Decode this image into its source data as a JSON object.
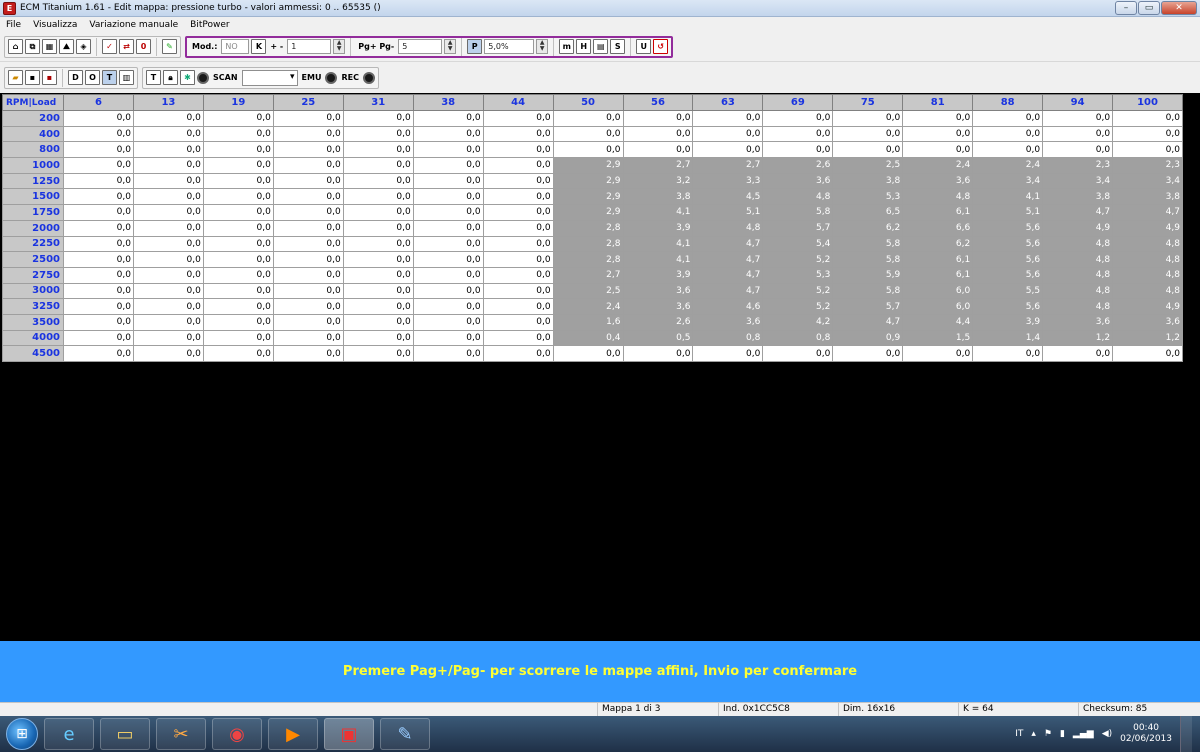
{
  "window": {
    "title": "ECM Titanium 1.61 - Edit mappa: pressione turbo - valori ammessi: 0 .. 65535 ()"
  },
  "menu": [
    "File",
    "Visualizza",
    "Variazione manuale",
    "BitPower"
  ],
  "toolbar": {
    "mod_label": "Mod.:",
    "mod_value": "NO",
    "k_label": "K",
    "plusminus_label": "+ -",
    "plusminus_value": "1",
    "pg_label": "Pg+ Pg-",
    "pg_value": "5",
    "percent_value": "5,0%",
    "scan_label": "SCAN",
    "emu_label": "EMU",
    "rec_label": "REC"
  },
  "table": {
    "corner": "RPM|Load",
    "loads": [
      "6",
      "13",
      "19",
      "25",
      "31",
      "38",
      "44",
      "50",
      "56",
      "63",
      "69",
      "75",
      "81",
      "88",
      "94",
      "100"
    ],
    "rows": [
      {
        "rpm": "200",
        "vals": [
          "0,0",
          "0,0",
          "0,0",
          "0,0",
          "0,0",
          "0,0",
          "0,0",
          "0,0",
          "0,0",
          "0,0",
          "0,0",
          "0,0",
          "0,0",
          "0,0",
          "0,0",
          "0,0"
        ]
      },
      {
        "rpm": "400",
        "vals": [
          "0,0",
          "0,0",
          "0,0",
          "0,0",
          "0,0",
          "0,0",
          "0,0",
          "0,0",
          "0,0",
          "0,0",
          "0,0",
          "0,0",
          "0,0",
          "0,0",
          "0,0",
          "0,0"
        ]
      },
      {
        "rpm": "800",
        "vals": [
          "0,0",
          "0,0",
          "0,0",
          "0,0",
          "0,0",
          "0,0",
          "0,0",
          "0,0",
          "0,0",
          "0,0",
          "0,0",
          "0,0",
          "0,0",
          "0,0",
          "0,0",
          "0,0"
        ]
      },
      {
        "rpm": "1000",
        "vals": [
          "0,0",
          "0,0",
          "0,0",
          "0,0",
          "0,0",
          "0,0",
          "0,0",
          "2,9",
          "2,7",
          "2,7",
          "2,6",
          "2,5",
          "2,4",
          "2,4",
          "2,3",
          "2,3"
        ]
      },
      {
        "rpm": "1250",
        "vals": [
          "0,0",
          "0,0",
          "0,0",
          "0,0",
          "0,0",
          "0,0",
          "0,0",
          "2,9",
          "3,2",
          "3,3",
          "3,6",
          "3,8",
          "3,6",
          "3,4",
          "3,4",
          "3,4"
        ]
      },
      {
        "rpm": "1500",
        "vals": [
          "0,0",
          "0,0",
          "0,0",
          "0,0",
          "0,0",
          "0,0",
          "0,0",
          "2,9",
          "3,8",
          "4,5",
          "4,8",
          "5,3",
          "4,8",
          "4,1",
          "3,8",
          "3,8"
        ]
      },
      {
        "rpm": "1750",
        "vals": [
          "0,0",
          "0,0",
          "0,0",
          "0,0",
          "0,0",
          "0,0",
          "0,0",
          "2,9",
          "4,1",
          "5,1",
          "5,8",
          "6,5",
          "6,1",
          "5,1",
          "4,7",
          "4,7"
        ]
      },
      {
        "rpm": "2000",
        "vals": [
          "0,0",
          "0,0",
          "0,0",
          "0,0",
          "0,0",
          "0,0",
          "0,0",
          "2,8",
          "3,9",
          "4,8",
          "5,7",
          "6,2",
          "6,6",
          "5,6",
          "4,9",
          "4,9"
        ]
      },
      {
        "rpm": "2250",
        "vals": [
          "0,0",
          "0,0",
          "0,0",
          "0,0",
          "0,0",
          "0,0",
          "0,0",
          "2,8",
          "4,1",
          "4,7",
          "5,4",
          "5,8",
          "6,2",
          "5,6",
          "4,8",
          "4,8"
        ]
      },
      {
        "rpm": "2500",
        "vals": [
          "0,0",
          "0,0",
          "0,0",
          "0,0",
          "0,0",
          "0,0",
          "0,0",
          "2,8",
          "4,1",
          "4,7",
          "5,2",
          "5,8",
          "6,1",
          "5,6",
          "4,8",
          "4,8"
        ]
      },
      {
        "rpm": "2750",
        "vals": [
          "0,0",
          "0,0",
          "0,0",
          "0,0",
          "0,0",
          "0,0",
          "0,0",
          "2,7",
          "3,9",
          "4,7",
          "5,3",
          "5,9",
          "6,1",
          "5,6",
          "4,8",
          "4,8"
        ]
      },
      {
        "rpm": "3000",
        "vals": [
          "0,0",
          "0,0",
          "0,0",
          "0,0",
          "0,0",
          "0,0",
          "0,0",
          "2,5",
          "3,6",
          "4,7",
          "5,2",
          "5,8",
          "6,0",
          "5,5",
          "4,8",
          "4,8"
        ]
      },
      {
        "rpm": "3250",
        "vals": [
          "0,0",
          "0,0",
          "0,0",
          "0,0",
          "0,0",
          "0,0",
          "0,0",
          "2,4",
          "3,6",
          "4,6",
          "5,2",
          "5,7",
          "6,0",
          "5,6",
          "4,8",
          "4,9"
        ]
      },
      {
        "rpm": "3500",
        "vals": [
          "0,0",
          "0,0",
          "0,0",
          "0,0",
          "0,0",
          "0,0",
          "0,0",
          "1,6",
          "2,6",
          "3,6",
          "4,2",
          "4,7",
          "4,4",
          "3,9",
          "3,6",
          "3,6"
        ]
      },
      {
        "rpm": "4000",
        "vals": [
          "0,0",
          "0,0",
          "0,0",
          "0,0",
          "0,0",
          "0,0",
          "0,0",
          "0,4",
          "0,5",
          "0,8",
          "0,8",
          "0,9",
          "1,5",
          "1,4",
          "1,2",
          "1,2"
        ]
      },
      {
        "rpm": "4500",
        "vals": [
          "0,0",
          "0,0",
          "0,0",
          "0,0",
          "0,0",
          "0,0",
          "0,0",
          "0,0",
          "0,0",
          "0,0",
          "0,0",
          "0,0",
          "0,0",
          "0,0",
          "0,0",
          "0,0"
        ]
      }
    ],
    "highlight": {
      "rows": [
        "1000",
        "1250",
        "1500",
        "1750",
        "2000",
        "2250",
        "2500",
        "2750",
        "3000",
        "3250",
        "3500",
        "4000"
      ],
      "from_col": 7
    }
  },
  "message": "Premere Pag+/Pag- per scorrere le mappe affini, Invio per confermare",
  "status": {
    "mappa": "Mappa 1 di 3",
    "ind": "Ind. 0x1CC5C8",
    "dim": "Dim. 16x16",
    "k": "K = 64",
    "checksum": "Checksum: 85"
  },
  "taskbar": {
    "lang": "IT",
    "time": "00:40",
    "date": "02/06/2013"
  },
  "colors": {
    "header_text": "#1a34e0",
    "highlight_cell": "#a0a0a0",
    "message_bg": "#3399ff",
    "message_text": "#ffff33"
  }
}
